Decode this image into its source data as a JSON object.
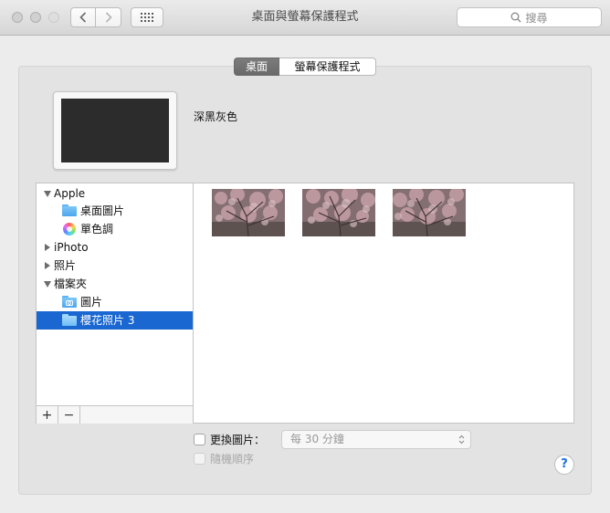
{
  "window": {
    "title": "桌面與螢幕保護程式",
    "search_placeholder": "搜尋"
  },
  "tabs": [
    {
      "label": "桌面",
      "active": true
    },
    {
      "label": "螢幕保護程式",
      "active": false
    }
  ],
  "preview": {
    "color_name": "深黑灰色",
    "preview_color": "#2c2c2c"
  },
  "sidebar": {
    "items": [
      {
        "label": "Apple",
        "kind": "group",
        "expanded": true
      },
      {
        "label": "桌面圖片",
        "kind": "folder-icon"
      },
      {
        "label": "單色調",
        "kind": "color-wheel-icon"
      },
      {
        "label": "iPhoto",
        "kind": "group",
        "expanded": false
      },
      {
        "label": "照片",
        "kind": "group",
        "expanded": false
      },
      {
        "label": "檔案夾",
        "kind": "group",
        "expanded": true
      },
      {
        "label": "圖片",
        "kind": "camera-folder-icon"
      },
      {
        "label": "櫻花照片 3",
        "kind": "folder-icon",
        "selected": true
      }
    ],
    "add_label": "+",
    "remove_label": "−"
  },
  "images": [
    {
      "name": "cherry-blossom-1"
    },
    {
      "name": "cherry-blossom-2"
    },
    {
      "name": "cherry-blossom-3"
    }
  ],
  "controls": {
    "change_picture_label": "更換圖片：",
    "change_picture_checked": false,
    "interval_value": "每 30 分鐘",
    "random_order_label": "隨機順序",
    "random_order_checked": false,
    "help_label": "?"
  },
  "colors": {
    "selection": "#1a67d1",
    "folder": "#5fb3f0",
    "help_accent": "#1c6ee0"
  }
}
